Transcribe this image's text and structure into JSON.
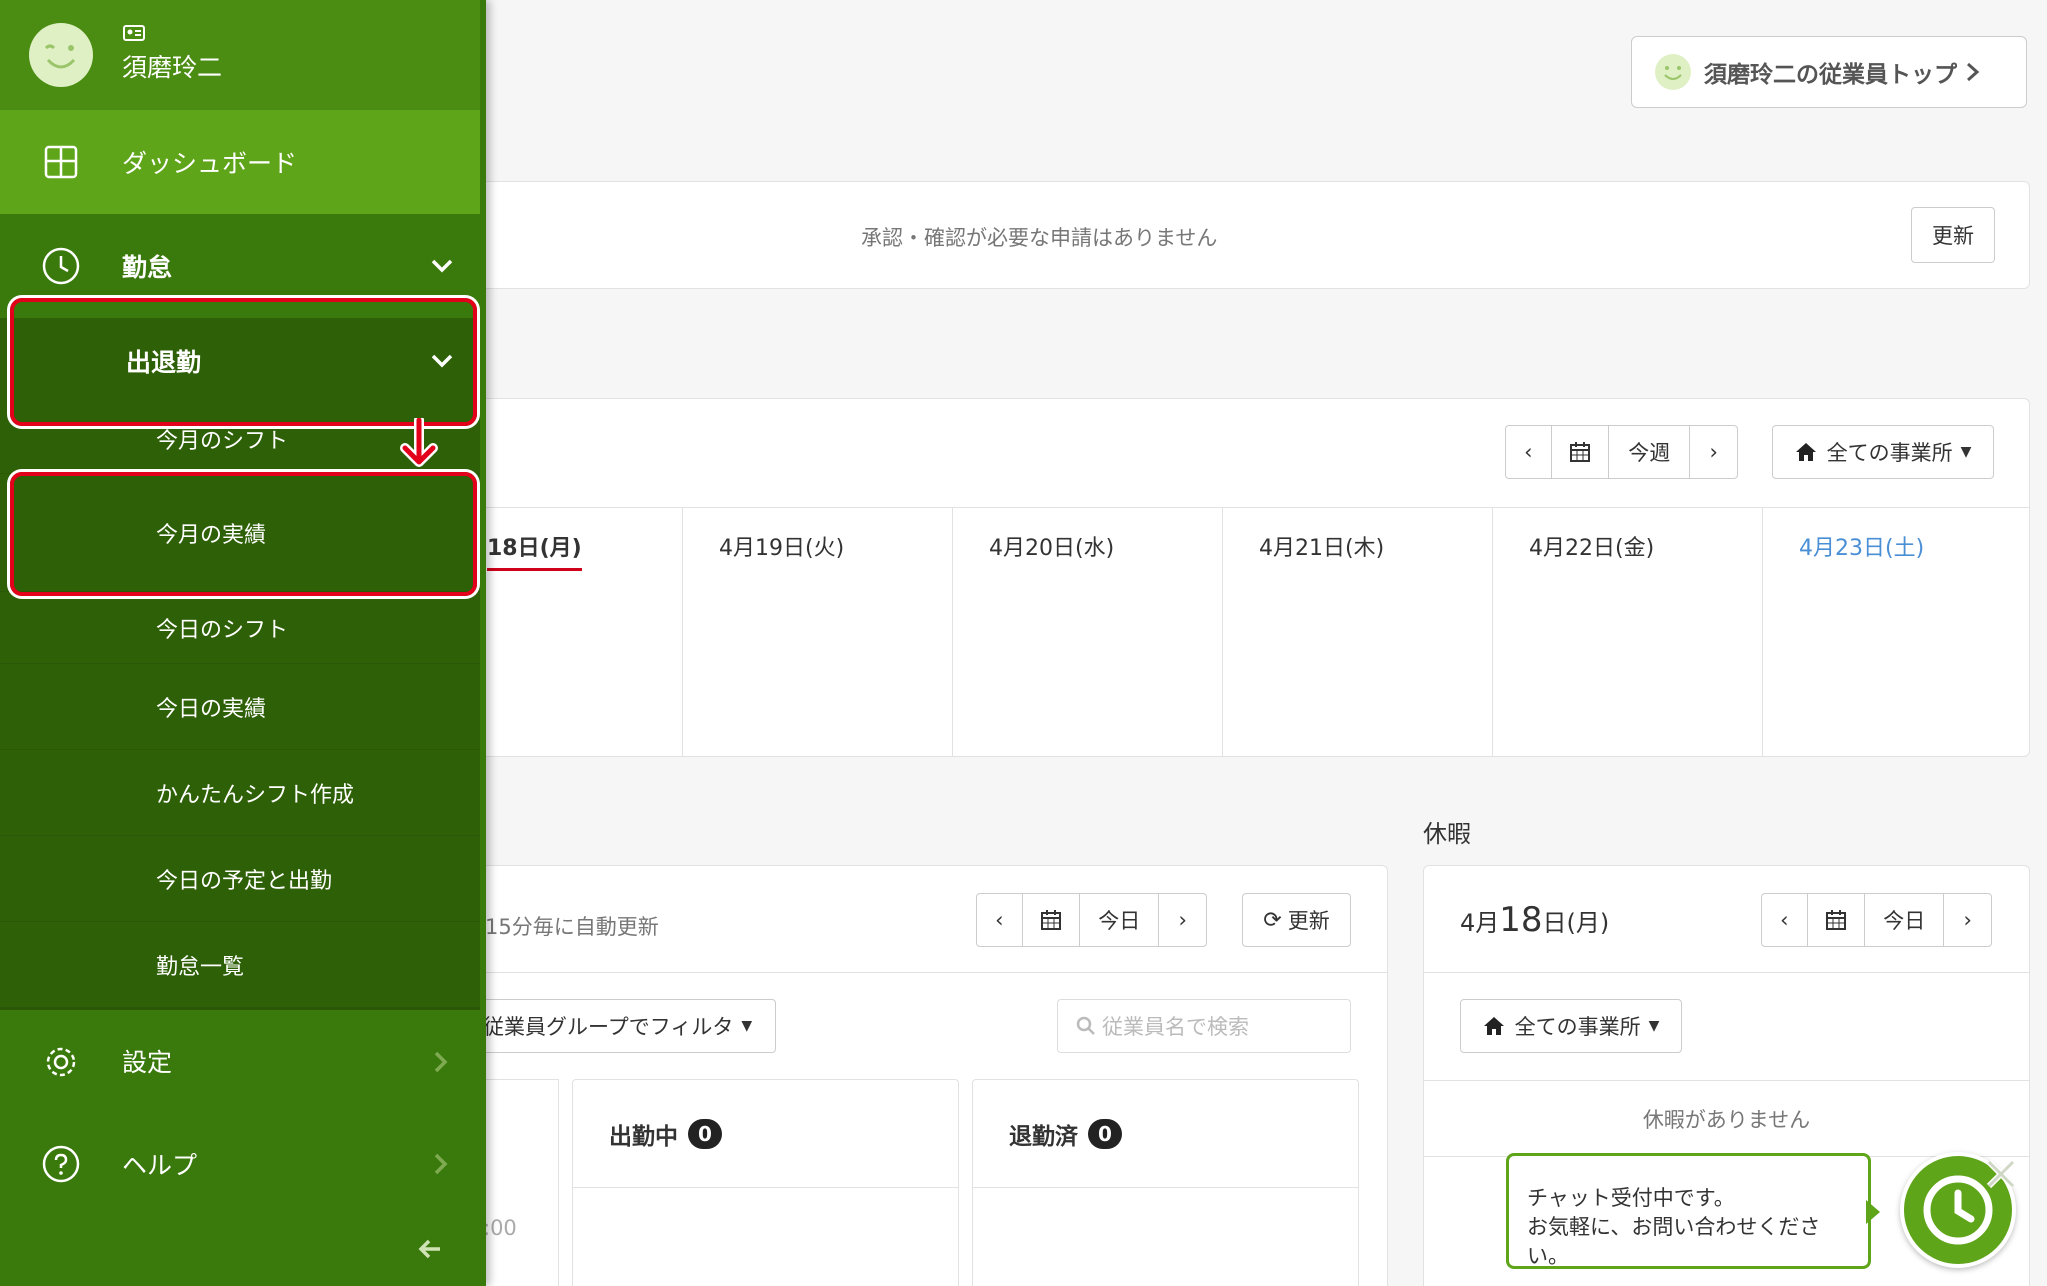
{
  "header": {
    "employee_top_button": "須磨玲二の従業員トップ"
  },
  "approvals": {
    "message": "承認・確認が必要な申請はありません",
    "refresh": "更新"
  },
  "week": {
    "nav": {
      "prev": "‹",
      "today": "今週",
      "next": "›"
    },
    "office_filter": "全ての事業所",
    "days": [
      "18日(月)",
      "4月19日(火)",
      "4月20日(水)",
      "4月21日(木)",
      "4月22日(金)",
      "4月23日(土)"
    ]
  },
  "attendance": {
    "auto_refresh": "15分毎に自動更新",
    "nav": {
      "prev": "‹",
      "today": "今日",
      "next": "›"
    },
    "refresh": "更新",
    "group_filter": "従業員グループでフィルタ",
    "search_placeholder": "従業員名で検索",
    "col1_time": ":00",
    "on_duty": {
      "label": "出勤中",
      "count": "0"
    },
    "off_duty": {
      "label": "退勤済",
      "count": "0"
    }
  },
  "leave": {
    "heading": "休暇",
    "date_month": "4月",
    "date_day": "18",
    "date_suffix": "日(月)",
    "nav": {
      "prev": "‹",
      "today": "今日",
      "next": "›"
    },
    "office_filter": "全ての事業所",
    "empty": "休暇がありません"
  },
  "chat": {
    "line1": "チャット受付中です。",
    "line2": "お気軽に、お問い合わせください。"
  },
  "sidebar": {
    "user_name": "須磨玲二",
    "dashboard": "ダッシュボード",
    "attendance_menu": "勤怠",
    "clock_in_out": "出退勤",
    "sub_items": [
      "今月のシフト",
      "今月の実績",
      "今日のシフト",
      "今日の実績",
      "かんたんシフト作成",
      "今日の予定と出勤",
      "勤怠一覧"
    ],
    "settings": "設定",
    "help": "ヘルプ"
  },
  "colors": {
    "sidebar": "#3a7a0d",
    "active": "#5fa51a",
    "submenu": "#2e6007",
    "highlight": "#e3001b",
    "saturday": "#4a8fd6"
  }
}
